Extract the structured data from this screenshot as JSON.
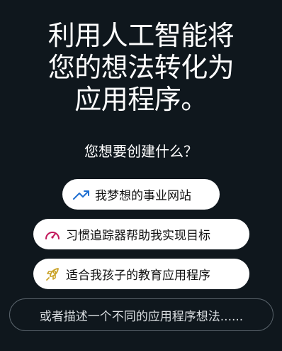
{
  "headline": {
    "line1": "利用人工智能将",
    "line2": "您的想法转化为",
    "line3": "应用程序。"
  },
  "question": "您想要创建什么？",
  "suggestions": [
    {
      "label": "我梦想的事业网站",
      "icon": "trending-up-icon",
      "icon_color": "#1f6fd1"
    },
    {
      "label": "习惯追踪器帮助我实现目标",
      "icon": "speedometer-icon",
      "icon_color": "#c2185b"
    },
    {
      "label": "适合我孩子的教育应用程序",
      "icon": "rocket-icon",
      "icon_color": "#c9a227"
    }
  ],
  "describe_placeholder": "或者描述一个不同的应用程序想法......",
  "colors": {
    "background": "#0f171d",
    "chip_background": "#ffffff",
    "chip_text": "#111111",
    "outline": "#59636b"
  }
}
